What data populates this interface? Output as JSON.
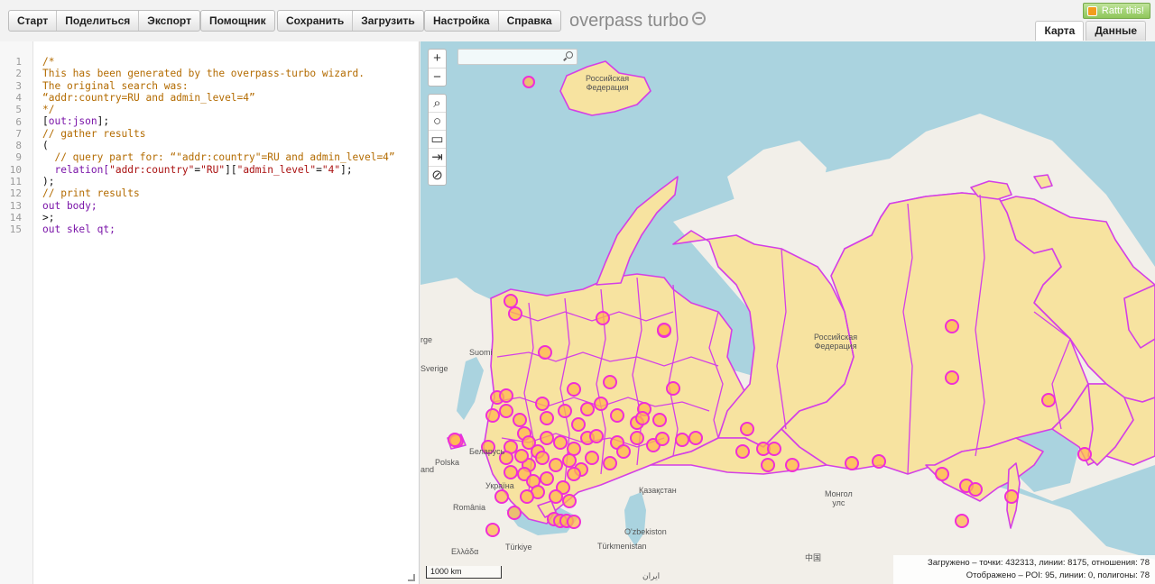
{
  "toolbar": {
    "groups": [
      [
        "Старт",
        "Поделиться",
        "Экспорт"
      ],
      [
        "Помощник"
      ],
      [
        "Сохранить",
        "Загрузить"
      ],
      [
        "Настройка",
        "Справка"
      ]
    ],
    "brand": "overpass turbo",
    "rattr_label": "Rattr this!",
    "tabs": [
      "Карта",
      "Данные"
    ],
    "active_tab": "Карта"
  },
  "editor": {
    "line_numbers": [
      "1",
      "2",
      "3",
      "4",
      "5",
      "6",
      "7",
      "8",
      "9",
      "10",
      "11",
      "12",
      "13",
      "14",
      "15"
    ],
    "lines": [
      [
        {
          "t": "/*",
          "c": "comment"
        }
      ],
      [
        {
          "t": "This has been generated by the overpass-turbo wizard.",
          "c": "comment"
        }
      ],
      [
        {
          "t": "The original search was:",
          "c": "comment"
        }
      ],
      [
        {
          "t": "“addr:country=RU and admin_level=4”",
          "c": "comment"
        }
      ],
      [
        {
          "t": "*/",
          "c": "comment"
        }
      ],
      [
        {
          "t": "[",
          "c": "plain"
        },
        {
          "t": "out:json",
          "c": "kw"
        },
        {
          "t": "];",
          "c": "plain"
        }
      ],
      [
        {
          "t": "// gather results",
          "c": "comment"
        }
      ],
      [
        {
          "t": "(",
          "c": "plain"
        }
      ],
      [
        {
          "t": "  // query part for: “\"addr:country\"=RU and admin_level=4”",
          "c": "comment"
        }
      ],
      [
        {
          "t": "  relation[",
          "c": "kw"
        },
        {
          "t": "\"addr:country\"",
          "c": "str"
        },
        {
          "t": "=",
          "c": "plain"
        },
        {
          "t": "\"RU\"",
          "c": "str"
        },
        {
          "t": "][",
          "c": "plain"
        },
        {
          "t": "\"admin_level\"",
          "c": "str"
        },
        {
          "t": "=",
          "c": "plain"
        },
        {
          "t": "\"4\"",
          "c": "str"
        },
        {
          "t": "];",
          "c": "plain"
        }
      ],
      [
        {
          "t": ");",
          "c": "plain"
        }
      ],
      [
        {
          "t": "// print results",
          "c": "comment"
        }
      ],
      [
        {
          "t": "out body;",
          "c": "kw"
        }
      ],
      [
        {
          "t": ">;",
          "c": "plain"
        }
      ],
      [
        {
          "t": "out skel qt;",
          "c": "kw"
        }
      ]
    ]
  },
  "map": {
    "zoom_in": "+",
    "zoom_out": "−",
    "search_placeholder": "",
    "labels": {
      "rf_north": "Российская\nФедерация",
      "rf_main": "Российская\nФедерация",
      "suomi": "Suomi",
      "sverige": "Sverige",
      "belarus": "Беларусь",
      "polska": "Polska",
      "ukraina": "Україна",
      "romania": "România",
      "kazakhstan": "Қазақстан",
      "mongol": "Монгол\nулс",
      "turkiye": "Türkiye",
      "turkmenistan": "Türkmenistan",
      "ozbekiston": "O'zbekiston",
      "ellada": "Ελλάδα",
      "china": "中国",
      "iran": "ایران",
      "rge": "rge",
      "and": "and"
    },
    "scale": "1000 km",
    "stats_loaded": "Загружено – точки: 432313, линии: 8175, отношения: 78",
    "stats_shown": "Отображено – POI: 95, линии: 0, полигоны: 78"
  },
  "colors": {
    "ocean": "#aad3df",
    "land": "#f2efe9",
    "region_fill": "#f7e3a0",
    "region_stroke": "#d43fe6",
    "poi_fill": "#ffb84d",
    "poi_stroke": "#ef2fd6"
  }
}
